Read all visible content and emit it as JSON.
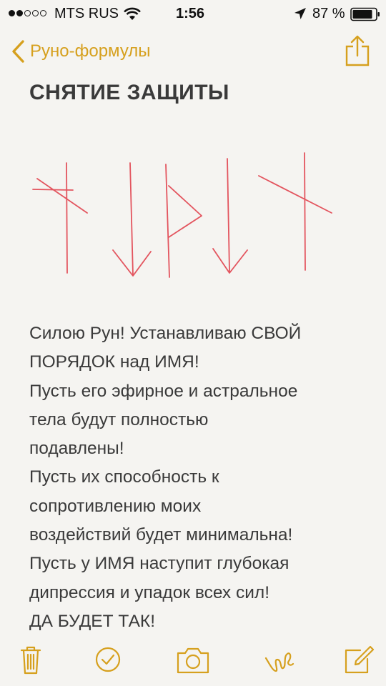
{
  "status_bar": {
    "carrier": "MTS RUS",
    "time": "1:56",
    "battery_percent": "87 %",
    "signal_strength": 2,
    "signal_max": 5
  },
  "nav": {
    "back_label": "Руно-формулы",
    "accent_color": "#d6a01e"
  },
  "note": {
    "title": "СНЯТИЕ ЗАЩИТЫ",
    "body_lines": [
      "Силою Рун! Устанавливаю СВОЙ",
      "ПОРЯДОК над ИМЯ!",
      "Пусть его эфирное и астральное",
      "тела будут полностью",
      "подавлены!",
      "Пусть их способность к",
      "сопротивлению моих",
      "воздействий будет минимальна!",
      "Пусть у ИМЯ наступит глубокая",
      "дипрессия и упадок всех сил!",
      "ДА БУДЕТ ТАК!"
    ],
    "drawing_color": "#e3545e"
  },
  "toolbar": {
    "icons": [
      "trash-icon",
      "checklist-icon",
      "camera-icon",
      "sketch-icon",
      "compose-icon"
    ]
  }
}
